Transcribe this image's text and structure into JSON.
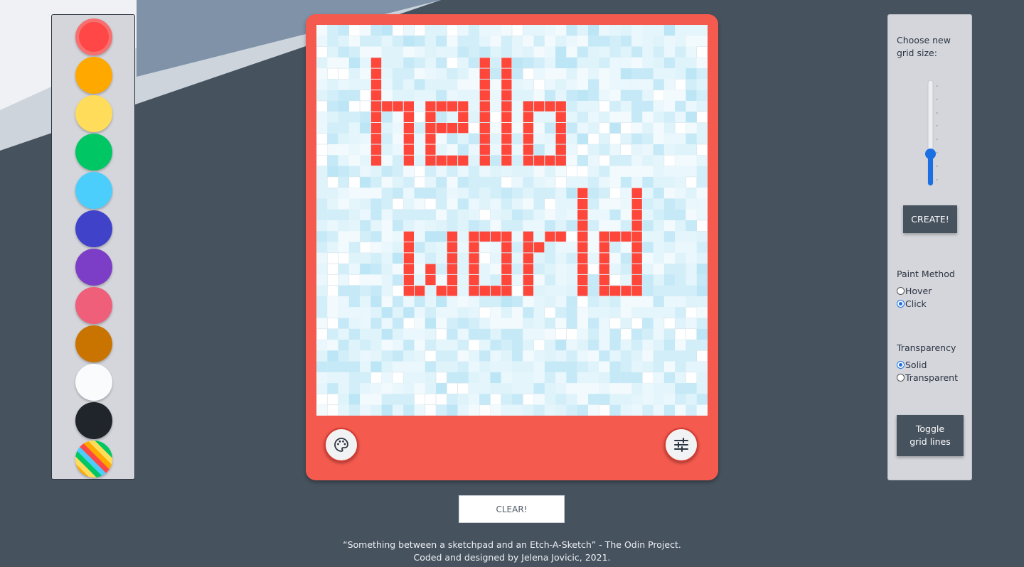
{
  "palette": {
    "colors": [
      "#ff4747",
      "#ffa800",
      "#ffdc5a",
      "#00c764",
      "#4ccefc",
      "#4042c9",
      "#7c3ec6",
      "#ef5f7a",
      "#c97400",
      "#fafbfd",
      "#20252b",
      "rainbow"
    ],
    "selected_index": 0
  },
  "canvas": {
    "text_lines": [
      "hello",
      "world"
    ],
    "paint_color": "#ff463a",
    "base_color": "#e9f6fb",
    "grid_cells": 36
  },
  "controls": {
    "palette_icon": "palette-icon",
    "settings_icon": "sliders-icon",
    "clear_label": "CLEAR!"
  },
  "settings": {
    "grid_size_label": [
      "Choose new",
      "grid size:"
    ],
    "grid_size_value": 0.3,
    "create_label": "CREATE!",
    "paint_method_title": "Paint Method",
    "paint_methods": [
      "Hover",
      "Click"
    ],
    "paint_method_selected": "Click",
    "transparency_title": "Transparency",
    "transparency_options": [
      "Solid",
      "Transparent"
    ],
    "transparency_selected": "Solid",
    "toggle_grid_label": [
      "Toggle",
      "grid lines"
    ]
  },
  "footer": {
    "line1": "“Something between a sketchpad and an Etch-A-Sketch” - The Odin Project.",
    "line2": "Coded and designed by Jelena Jovicic, 2021."
  }
}
